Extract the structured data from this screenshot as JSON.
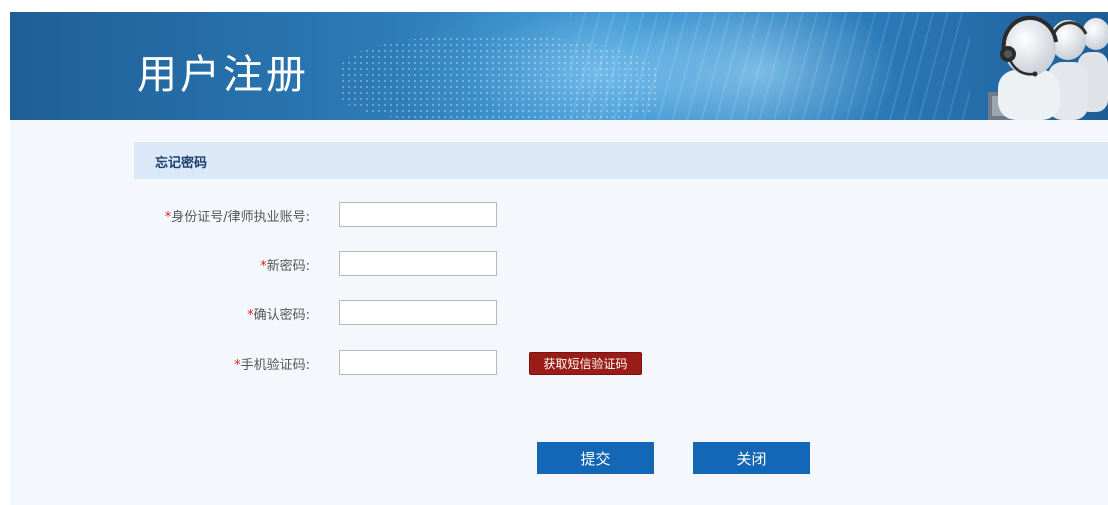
{
  "banner": {
    "title": "用户注册"
  },
  "section": {
    "title": "忘记密码"
  },
  "form": {
    "required_mark": "*",
    "fields": [
      {
        "label": "身份证号/律师执业账号:",
        "value": "",
        "placeholder": ""
      },
      {
        "label": "新密码:",
        "value": "",
        "placeholder": ""
      },
      {
        "label": "确认密码:",
        "value": "",
        "placeholder": ""
      },
      {
        "label": "手机验证码:",
        "value": "",
        "placeholder": ""
      }
    ],
    "sms_button_label": "获取短信验证码"
  },
  "actions": {
    "submit_label": "提交",
    "close_label": "关闭"
  },
  "colors": {
    "banner_blue": "#2a77b3",
    "section_bg": "#dbe8f7",
    "primary_button": "#1467b6",
    "sms_button": "#9a1c16",
    "required_star": "#e02020"
  }
}
